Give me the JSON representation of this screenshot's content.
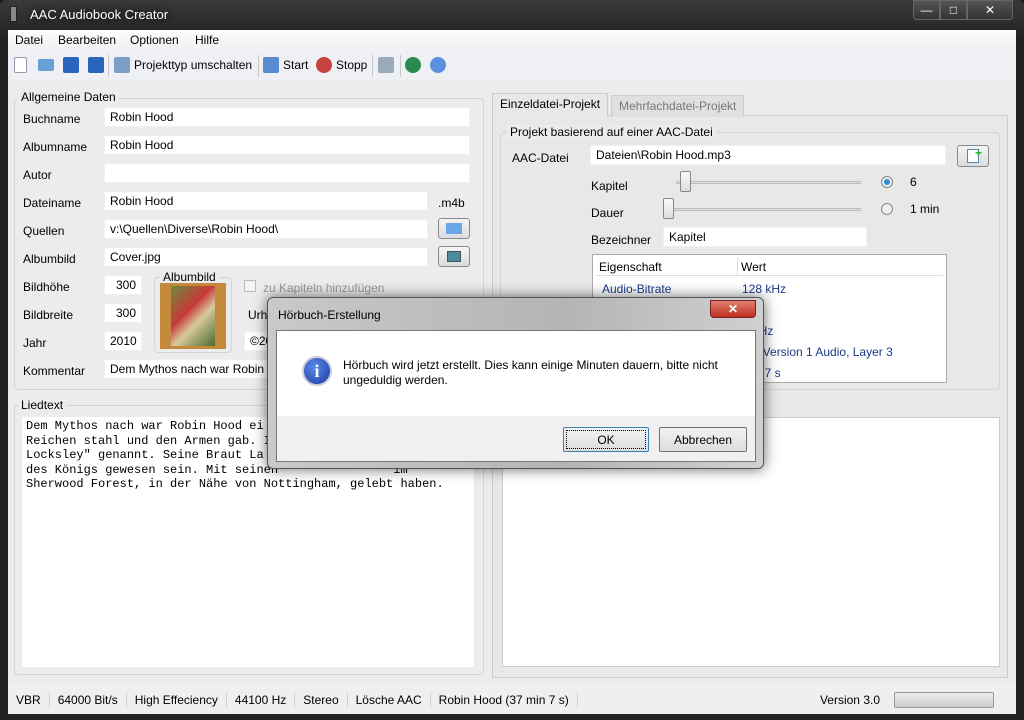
{
  "window": {
    "title": "AAC Audiobook Creator",
    "minimize": "—",
    "maximize": "□",
    "close": "✕"
  },
  "menu": [
    "Datei",
    "Bearbeiten",
    "Optionen",
    "Hilfe"
  ],
  "toolbar": {
    "switch_label": "Projekttyp umschalten",
    "start_label": "Start",
    "stop_label": "Stopp"
  },
  "general": {
    "title": "Allgemeine Daten",
    "fields": [
      {
        "label": "Buchname",
        "value": "Robin Hood"
      },
      {
        "label": "Albumname",
        "value": "Robin Hood"
      },
      {
        "label": "Autor",
        "value": ""
      },
      {
        "label": "Dateiname",
        "value": "Robin Hood"
      },
      {
        "label": "Quellen",
        "value": "v:\\Quellen\\Diverse\\Robin Hood\\"
      },
      {
        "label": "Albumbild",
        "value": "Cover.jpg"
      }
    ],
    "extension": ".m4b",
    "height_label": "Bildhöhe",
    "height_value": "300",
    "width_label": "Bildbreite",
    "width_value": "300",
    "year_label": "Jahr",
    "year_value": "2010",
    "comment_label": "Kommentar",
    "comment_value": "Dem Mythos nach war Robin H",
    "cover_group": "Albumbild",
    "add_to_chapters": "zu Kapiteln hinzufügen",
    "copyright_label": "Urh",
    "copyright_value": "©20"
  },
  "lyrics": {
    "title": "Liedtext",
    "lines": [
      "Dem Mythos nach war Robin Hood ei",
      "Reichen stahl und den Armen gab. I",
      "Locksley\" genannt. Seine Braut La",
      "des Königs gewesen sein. Mit seinen                im",
      "Sherwood Forest, in der Nähe von Nottingham, gelebt haben."
    ]
  },
  "tabs": [
    {
      "label": "Einzeldatei-Projekt",
      "active": true
    },
    {
      "label": "Mehrfachdatei-Projekt",
      "active": false
    }
  ],
  "single": {
    "group": "Projekt basierend auf einer AAC-Datei",
    "file_label": "AAC-Datei",
    "file_value": "Dateien\\Robin Hood.mp3",
    "chapter_label": "Kapitel",
    "chapter_value": "6",
    "chapter_selected": true,
    "duration_label": "Dauer",
    "duration_value": "1 min",
    "duration_selected": false,
    "name_label": "Bezeichner",
    "name_value": "Kapitel",
    "table_headers": [
      "Eigenschaft",
      "Wert"
    ],
    "rows": [
      {
        "prop": "Audio-Bitrate",
        "value": "128 kHz"
      },
      {
        "prop": "",
        "value": ""
      },
      {
        "prop": "",
        "value": "00 Hz"
      },
      {
        "prop": "",
        "value": "EG Version 1 Audio, Layer 3"
      },
      {
        "prop": "",
        "value": "min 7 s"
      }
    ]
  },
  "status": {
    "items": [
      "VBR",
      "64000 Bit/s",
      "High Effeciency",
      "44100 Hz",
      "Stereo",
      "Lösche AAC",
      "Robin Hood  (37 min 7 s)"
    ],
    "version": "Version 3.0",
    "progress": 0
  },
  "dialog": {
    "title": "Hörbuch-Erstellung",
    "message": "Hörbuch wird jetzt erstellt. Dies kann einige Minuten dauern, bitte nicht ungeduldig werden.",
    "ok": "OK",
    "cancel": "Abbrechen",
    "close": "✕"
  }
}
